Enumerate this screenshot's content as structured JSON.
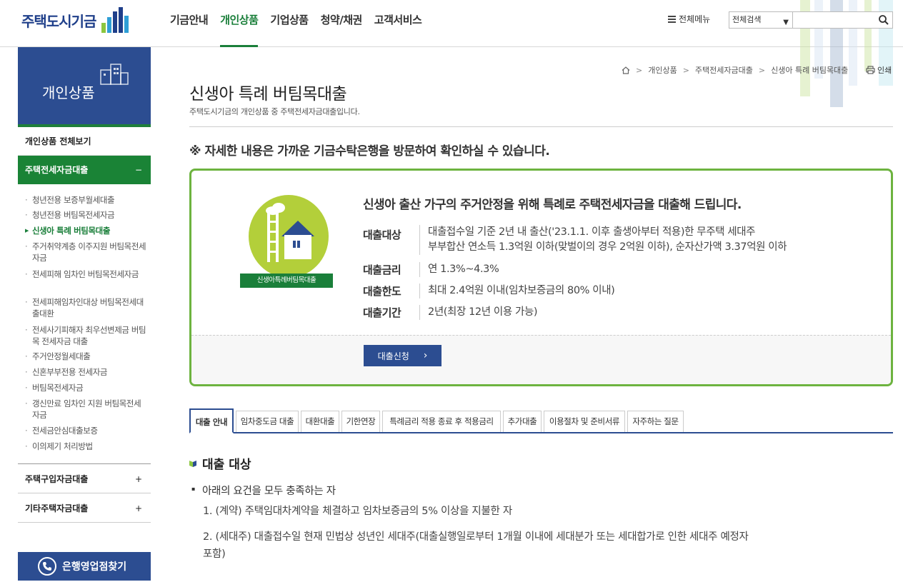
{
  "header": {
    "logo_text": "주택도시기금",
    "gnb": [
      "기금안내",
      "개인상품",
      "기업상품",
      "청약/채권",
      "고객서비스"
    ],
    "all_menu": "전체메뉴",
    "search_scope": "전체검색",
    "search_value": ""
  },
  "sidebar": {
    "title": "개인상품",
    "view_all": "개인상품 전체보기",
    "open_category": "주택전세자금대출",
    "open_sign": "−",
    "sub_items": [
      "청년전용 보증부월세대출",
      "청년전용 버팀목전세자금",
      "신생아 특례 버팀목대출",
      "주거취약계층 이주지원 버팀목전세자금",
      "전세피해 임차인 버팀목전세자금",
      "전세피해임차인대상 버팀목전세대출대환",
      "전세사기피해자 최우선변제금 버팀목 전세자금 대출",
      "주거안정월세대출",
      "신혼부부전용 전세자금",
      "버팀목전세자금",
      "갱신만료 임차인 지원 버팀목전세자금",
      "전세금안심대출보증",
      "이의제기 처리방법"
    ],
    "closed_categories": [
      {
        "label": "주택구입자금대출",
        "sign": "+"
      },
      {
        "label": "기타주택자금대출",
        "sign": "+"
      }
    ],
    "branch_button": "은행영업점찾기"
  },
  "breadcrumb": [
    "개인상품",
    "주택전세자금대출",
    "신생아 특례 버팀목대출"
  ],
  "print_label": "인쇄",
  "page": {
    "title": "신생아 특례 버팀목대출",
    "subtitle": "주택도시기금의 개인상품 중 주택전세자금대출입니다.",
    "notice": "※ 자세한 내용은 가까운 기금수탁은행을 방문하여 확인하실 수 있습니다."
  },
  "product": {
    "badge": "신생아특례버팀목대출",
    "headline": "신생아 출산 가구의 주거안정을 위해 특례로 주택전세자금을 대출해 드립니다.",
    "rows": [
      {
        "label": "대출대상",
        "lines": [
          "대출접수일 기준 2년 내 출산('23.1.1. 이후 출생아부터 적용)한 무주택 세대주",
          "부부합산 연소득 1.3억원 이하(맞벌이의 경우 2억원 이하), 순자산가액 3.37억원 이하"
        ]
      },
      {
        "label": "대출금리",
        "lines": [
          "연 1.3%~4.3%"
        ]
      },
      {
        "label": "대출한도",
        "lines": [
          "최대 2.4억원 이내(임차보증금의 80% 이내)"
        ]
      },
      {
        "label": "대출기간",
        "lines": [
          "2년(최장 12년 이용 가능)"
        ]
      }
    ],
    "apply_button": "대출신청"
  },
  "tabs": [
    "대출 안내",
    "임차중도금 대출",
    "대환대출",
    "기한연장",
    "특례금리 적용 종료 후 적용금리",
    "추가대출",
    "이용절차 및 준비서류",
    "자주하는 질문"
  ],
  "section": {
    "title": "대출 대상",
    "bullet": "아래의 요건을 모두 충족하는 자",
    "items": [
      "1. (계약) 주택임대차계약을 체결하고 임차보증금의 5% 이상을 지불한 자",
      "2. (세대주) 대출접수일 현재 민법상 성년인 세대주(대출실행일로부터 1개월 이내에 세대분가 또는 세대합가로 인한 세대주 예정자",
      "포함)"
    ]
  },
  "colors": {
    "brand_blue": "#2c4d91",
    "brand_green": "#1a7f3a",
    "box_border": "#6db33f"
  }
}
